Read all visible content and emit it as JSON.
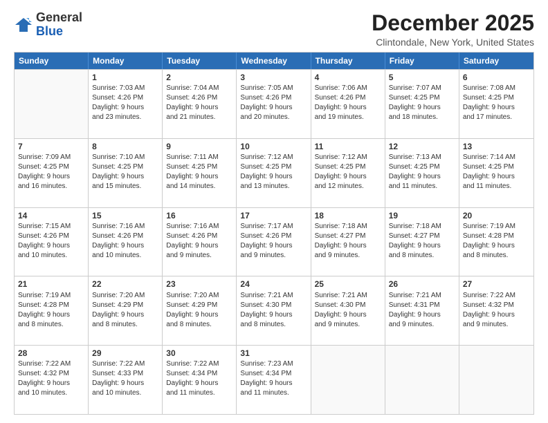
{
  "logo": {
    "general": "General",
    "blue": "Blue"
  },
  "title": "December 2025",
  "subtitle": "Clintondale, New York, United States",
  "headers": [
    "Sunday",
    "Monday",
    "Tuesday",
    "Wednesday",
    "Thursday",
    "Friday",
    "Saturday"
  ],
  "weeks": [
    [
      {
        "day": "",
        "lines": []
      },
      {
        "day": "1",
        "lines": [
          "Sunrise: 7:03 AM",
          "Sunset: 4:26 PM",
          "Daylight: 9 hours",
          "and 23 minutes."
        ]
      },
      {
        "day": "2",
        "lines": [
          "Sunrise: 7:04 AM",
          "Sunset: 4:26 PM",
          "Daylight: 9 hours",
          "and 21 minutes."
        ]
      },
      {
        "day": "3",
        "lines": [
          "Sunrise: 7:05 AM",
          "Sunset: 4:26 PM",
          "Daylight: 9 hours",
          "and 20 minutes."
        ]
      },
      {
        "day": "4",
        "lines": [
          "Sunrise: 7:06 AM",
          "Sunset: 4:26 PM",
          "Daylight: 9 hours",
          "and 19 minutes."
        ]
      },
      {
        "day": "5",
        "lines": [
          "Sunrise: 7:07 AM",
          "Sunset: 4:25 PM",
          "Daylight: 9 hours",
          "and 18 minutes."
        ]
      },
      {
        "day": "6",
        "lines": [
          "Sunrise: 7:08 AM",
          "Sunset: 4:25 PM",
          "Daylight: 9 hours",
          "and 17 minutes."
        ]
      }
    ],
    [
      {
        "day": "7",
        "lines": [
          "Sunrise: 7:09 AM",
          "Sunset: 4:25 PM",
          "Daylight: 9 hours",
          "and 16 minutes."
        ]
      },
      {
        "day": "8",
        "lines": [
          "Sunrise: 7:10 AM",
          "Sunset: 4:25 PM",
          "Daylight: 9 hours",
          "and 15 minutes."
        ]
      },
      {
        "day": "9",
        "lines": [
          "Sunrise: 7:11 AM",
          "Sunset: 4:25 PM",
          "Daylight: 9 hours",
          "and 14 minutes."
        ]
      },
      {
        "day": "10",
        "lines": [
          "Sunrise: 7:12 AM",
          "Sunset: 4:25 PM",
          "Daylight: 9 hours",
          "and 13 minutes."
        ]
      },
      {
        "day": "11",
        "lines": [
          "Sunrise: 7:12 AM",
          "Sunset: 4:25 PM",
          "Daylight: 9 hours",
          "and 12 minutes."
        ]
      },
      {
        "day": "12",
        "lines": [
          "Sunrise: 7:13 AM",
          "Sunset: 4:25 PM",
          "Daylight: 9 hours",
          "and 11 minutes."
        ]
      },
      {
        "day": "13",
        "lines": [
          "Sunrise: 7:14 AM",
          "Sunset: 4:25 PM",
          "Daylight: 9 hours",
          "and 11 minutes."
        ]
      }
    ],
    [
      {
        "day": "14",
        "lines": [
          "Sunrise: 7:15 AM",
          "Sunset: 4:26 PM",
          "Daylight: 9 hours",
          "and 10 minutes."
        ]
      },
      {
        "day": "15",
        "lines": [
          "Sunrise: 7:16 AM",
          "Sunset: 4:26 PM",
          "Daylight: 9 hours",
          "and 10 minutes."
        ]
      },
      {
        "day": "16",
        "lines": [
          "Sunrise: 7:16 AM",
          "Sunset: 4:26 PM",
          "Daylight: 9 hours",
          "and 9 minutes."
        ]
      },
      {
        "day": "17",
        "lines": [
          "Sunrise: 7:17 AM",
          "Sunset: 4:26 PM",
          "Daylight: 9 hours",
          "and 9 minutes."
        ]
      },
      {
        "day": "18",
        "lines": [
          "Sunrise: 7:18 AM",
          "Sunset: 4:27 PM",
          "Daylight: 9 hours",
          "and 9 minutes."
        ]
      },
      {
        "day": "19",
        "lines": [
          "Sunrise: 7:18 AM",
          "Sunset: 4:27 PM",
          "Daylight: 9 hours",
          "and 8 minutes."
        ]
      },
      {
        "day": "20",
        "lines": [
          "Sunrise: 7:19 AM",
          "Sunset: 4:28 PM",
          "Daylight: 9 hours",
          "and 8 minutes."
        ]
      }
    ],
    [
      {
        "day": "21",
        "lines": [
          "Sunrise: 7:19 AM",
          "Sunset: 4:28 PM",
          "Daylight: 9 hours",
          "and 8 minutes."
        ]
      },
      {
        "day": "22",
        "lines": [
          "Sunrise: 7:20 AM",
          "Sunset: 4:29 PM",
          "Daylight: 9 hours",
          "and 8 minutes."
        ]
      },
      {
        "day": "23",
        "lines": [
          "Sunrise: 7:20 AM",
          "Sunset: 4:29 PM",
          "Daylight: 9 hours",
          "and 8 minutes."
        ]
      },
      {
        "day": "24",
        "lines": [
          "Sunrise: 7:21 AM",
          "Sunset: 4:30 PM",
          "Daylight: 9 hours",
          "and 8 minutes."
        ]
      },
      {
        "day": "25",
        "lines": [
          "Sunrise: 7:21 AM",
          "Sunset: 4:30 PM",
          "Daylight: 9 hours",
          "and 9 minutes."
        ]
      },
      {
        "day": "26",
        "lines": [
          "Sunrise: 7:21 AM",
          "Sunset: 4:31 PM",
          "Daylight: 9 hours",
          "and 9 minutes."
        ]
      },
      {
        "day": "27",
        "lines": [
          "Sunrise: 7:22 AM",
          "Sunset: 4:32 PM",
          "Daylight: 9 hours",
          "and 9 minutes."
        ]
      }
    ],
    [
      {
        "day": "28",
        "lines": [
          "Sunrise: 7:22 AM",
          "Sunset: 4:32 PM",
          "Daylight: 9 hours",
          "and 10 minutes."
        ]
      },
      {
        "day": "29",
        "lines": [
          "Sunrise: 7:22 AM",
          "Sunset: 4:33 PM",
          "Daylight: 9 hours",
          "and 10 minutes."
        ]
      },
      {
        "day": "30",
        "lines": [
          "Sunrise: 7:22 AM",
          "Sunset: 4:34 PM",
          "Daylight: 9 hours",
          "and 11 minutes."
        ]
      },
      {
        "day": "31",
        "lines": [
          "Sunrise: 7:23 AM",
          "Sunset: 4:34 PM",
          "Daylight: 9 hours",
          "and 11 minutes."
        ]
      },
      {
        "day": "",
        "lines": []
      },
      {
        "day": "",
        "lines": []
      },
      {
        "day": "",
        "lines": []
      }
    ]
  ]
}
